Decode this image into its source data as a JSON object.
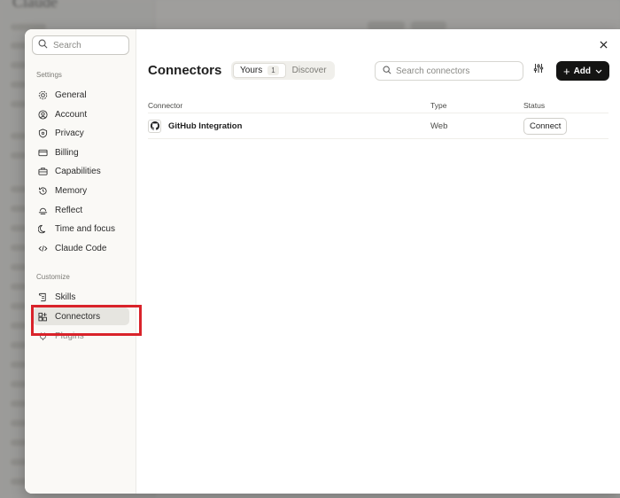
{
  "background": {
    "app_title": "Claude"
  },
  "sidebar": {
    "search_placeholder": "Search",
    "settings_label": "Settings",
    "settings_items": [
      {
        "label": "General",
        "icon": "gear-icon"
      },
      {
        "label": "Account",
        "icon": "user-circle-icon"
      },
      {
        "label": "Privacy",
        "icon": "shield-icon"
      },
      {
        "label": "Billing",
        "icon": "credit-card-icon"
      },
      {
        "label": "Capabilities",
        "icon": "briefcase-icon"
      },
      {
        "label": "Memory",
        "icon": "history-icon"
      },
      {
        "label": "Reflect",
        "icon": "sunset-icon"
      },
      {
        "label": "Time and focus",
        "icon": "moon-icon"
      },
      {
        "label": "Claude Code",
        "icon": "code-icon"
      }
    ],
    "customize_label": "Customize",
    "customize_items": [
      {
        "label": "Skills",
        "icon": "scroll-icon"
      },
      {
        "label": "Connectors",
        "icon": "grid-plus-icon",
        "active": true
      },
      {
        "label": "Plugins",
        "icon": "plug-icon"
      }
    ]
  },
  "main": {
    "title": "Connectors",
    "tabs": [
      {
        "label": "Yours",
        "count": "1",
        "active": true
      },
      {
        "label": "Discover",
        "active": false
      }
    ],
    "search_placeholder": "Search connectors",
    "add_label": "Add",
    "table": {
      "headers": [
        "Connector",
        "Type",
        "Status"
      ],
      "rows": [
        {
          "name": "GitHub Integration",
          "type": "Web",
          "action": "Connect",
          "icon": "github-icon"
        }
      ]
    }
  },
  "colors": {
    "highlight": "#d9232a",
    "add_button": "#141413",
    "active_nav": "#e6e5e0"
  }
}
